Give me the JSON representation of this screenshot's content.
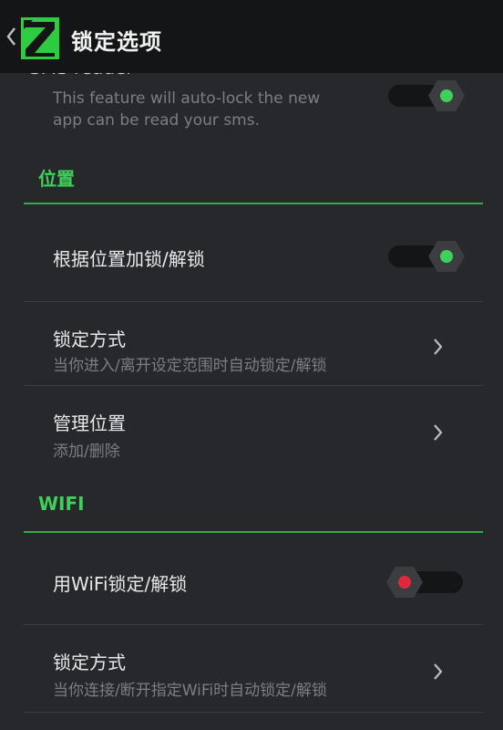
{
  "header": {
    "title": "锁定选项"
  },
  "sms": {
    "title_partial": "SMS reader",
    "description_line1": "This feature will auto-lock the new",
    "description_line2": "app can be read your sms.",
    "toggle_on": true
  },
  "sections": {
    "location": {
      "header": "位置",
      "lock_by_location": {
        "title": "根据位置加锁/解锁",
        "toggle_on": true
      },
      "lock_mode": {
        "title": "锁定方式",
        "subtitle": "当你进入/离开设定范围时自动锁定/解锁"
      },
      "manage": {
        "title": "管理位置",
        "subtitle": "添加/删除"
      }
    },
    "wifi": {
      "header": "WIFI",
      "lock_by_wifi": {
        "title": "用WiFi锁定/解锁",
        "toggle_on": false
      },
      "lock_mode": {
        "title": "锁定方式",
        "subtitle": "当你连接/断开指定WiFi时自动锁定/解锁"
      }
    }
  },
  "colors": {
    "accent_green": "#3fd05a",
    "toggle_off_red": "#e0283c",
    "background": "#26282b",
    "action_bar": "#141516"
  },
  "icons": {
    "back": "chevron-left-icon",
    "logo": "app-logo-icon",
    "chevron": "chevron-right-icon"
  }
}
